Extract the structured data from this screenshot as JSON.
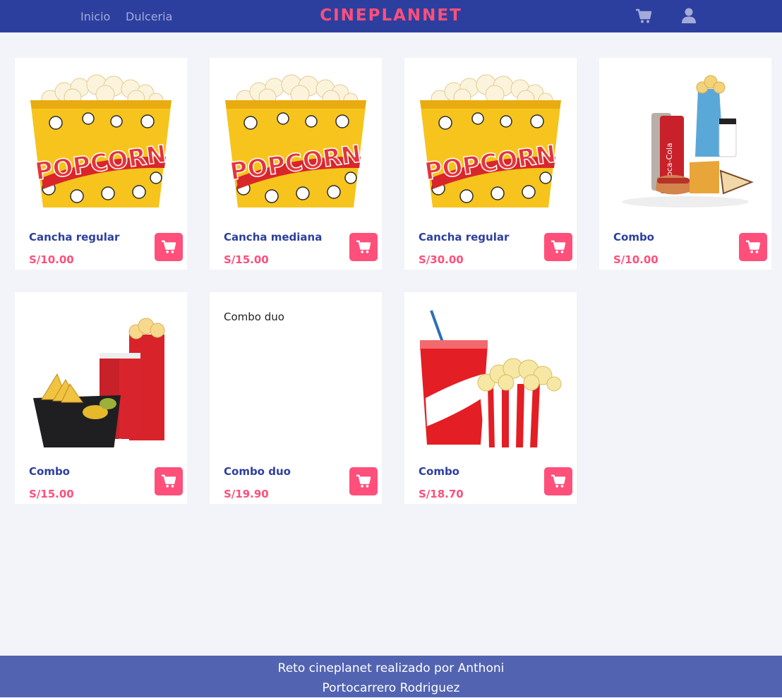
{
  "nav": {
    "links": [
      "Inicio",
      "Dulceria"
    ],
    "brand": "CINEPLANNET",
    "icons": [
      "cart-icon",
      "user-icon"
    ]
  },
  "products": [
    {
      "name": "Cancha regular",
      "price": "S/10.00",
      "image": "popcorn-bucket"
    },
    {
      "name": "Cancha mediana",
      "price": "S/15.00",
      "image": "popcorn-bucket"
    },
    {
      "name": "Cancha regular",
      "price": "S/30.00",
      "image": "popcorn-bucket"
    },
    {
      "name": "Combo",
      "price": "S/10.00",
      "image": "combo-snacks"
    },
    {
      "name": "Combo",
      "price": "S/15.00",
      "image": "combo-nachos"
    },
    {
      "name": "Combo duo",
      "price": "S/19.90",
      "image": "broken",
      "alt": "Combo duo"
    },
    {
      "name": "Combo",
      "price": "S/18.70",
      "image": "soda-popcorn"
    }
  ],
  "footer": {
    "line1": "Reto cineplanet realizado por Anthoni",
    "line2": "Portocarrero Rodriguez"
  },
  "colors": {
    "navbar": "#2d3f9e",
    "accent": "#ff4f7b",
    "footer": "#5263b1",
    "background": "#f3f4f9"
  }
}
